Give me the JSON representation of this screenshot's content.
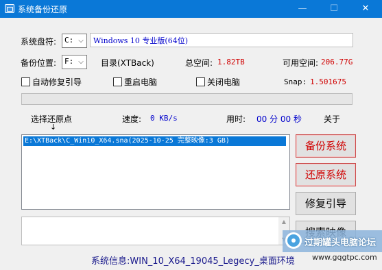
{
  "window": {
    "title": "系统备份还原",
    "min_glyph": "—",
    "max_glyph": "☐",
    "close_glyph": "✕"
  },
  "system_disk": {
    "label": "系统盘符:",
    "value": "C:",
    "os_name": "Windows 10 专业版(64位)"
  },
  "backup_location": {
    "label": "备份位置:",
    "value": "F:",
    "directory": "目录(XTBack)",
    "total_label": "总空间:",
    "total_value": "1.82TB",
    "free_label": "可用空间:",
    "free_value": "206.77G"
  },
  "options": {
    "auto_repair_boot": "自动修复引导",
    "restart_pc": "重启电脑",
    "shutdown_pc": "关闭电脑",
    "snap_label": "Snap:",
    "snap_value": "1.501675"
  },
  "progress": {
    "percent": 0
  },
  "status": {
    "select_point": "选择还原点",
    "down_arrow": "↓",
    "speed_label": "速度:",
    "speed_value": "0 KB/s",
    "elapsed_label": "用时:",
    "elapsed_value": "00 分 00 秒",
    "about": "关于"
  },
  "restore_points": [
    "E:\\XTBack\\C_Win10_X64.sna(2025-10-25 完整映像:3 GB)"
  ],
  "buttons": {
    "backup": "备份系统",
    "restore": "还原系统",
    "repair_boot": "修复引导",
    "search_image": "搜索映像"
  },
  "scroll_arrows": {
    "up": "▲",
    "down": "▼"
  },
  "system_info": "系统信息:WIN_10_X64_19045_Legecy_桌面环境",
  "watermark": {
    "text": "过期罐头电脑论坛",
    "url": "www.gqgtpc.com"
  },
  "colors": {
    "titlebar": "#0a78d7",
    "accent_red": "#d00000",
    "accent_blue": "#0000cc",
    "progress_fill": "#06b025"
  }
}
